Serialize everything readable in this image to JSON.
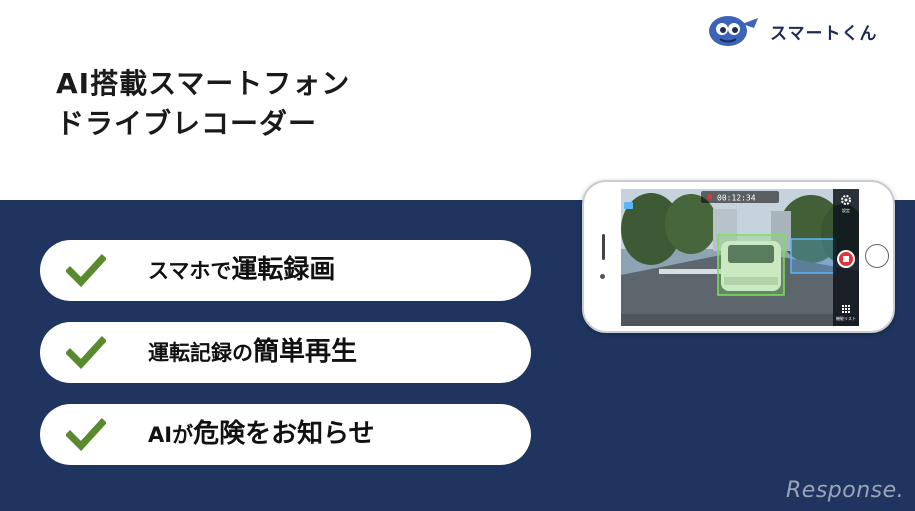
{
  "logo": {
    "name": "スマートくん"
  },
  "title": {
    "line1": "AI搭載スマートフォン",
    "line2": "ドライブレコーダー"
  },
  "features": [
    {
      "plain": "スマホで",
      "strong": "運転録画"
    },
    {
      "plain": "運転記録の",
      "strong": "簡単再生"
    },
    {
      "plain": "AIが",
      "strong": "危険をお知らせ"
    }
  ],
  "phone": {
    "timer": "00:12:34",
    "settings_label": "設定",
    "menu_label": "機能リスト",
    "record_color": "#e5333b"
  },
  "colors": {
    "band": "#1f3560",
    "check": "#5a8a2e",
    "detect_box": "#7ee05b",
    "detect_box_2": "#5ab7ff"
  },
  "watermark": "Response."
}
